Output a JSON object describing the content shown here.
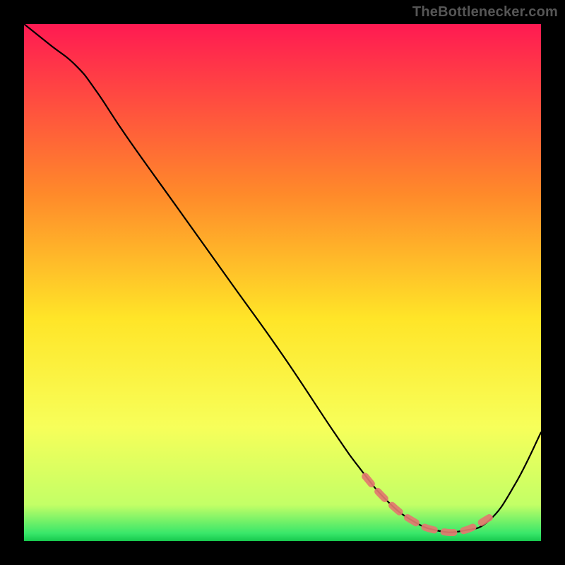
{
  "attribution": "TheBottlenecker.com",
  "chart_data": {
    "type": "line",
    "title": "",
    "xlabel": "",
    "ylabel": "",
    "xlim": [
      0,
      100
    ],
    "ylim": [
      0,
      100
    ],
    "series": [
      {
        "name": "bottleneck-curve",
        "x": [
          0,
          5,
          10,
          14,
          20,
          30,
          40,
          50,
          60,
          65,
          70,
          75,
          80,
          85,
          90,
          95,
          100
        ],
        "y": [
          100,
          96,
          92,
          87,
          78,
          64,
          50,
          36,
          21,
          14,
          8,
          4,
          2,
          2,
          4,
          11,
          21
        ]
      }
    ],
    "highlight_range": {
      "name": "optimal-zone",
      "x": [
        66,
        70,
        75,
        80,
        85,
        90
      ],
      "y": [
        12.5,
        8,
        4,
        2,
        2,
        4.5
      ]
    },
    "gradient_stops": [
      {
        "offset": 0,
        "color": "#ff1a52"
      },
      {
        "offset": 0.33,
        "color": "#ff8a2a"
      },
      {
        "offset": 0.57,
        "color": "#ffe528"
      },
      {
        "offset": 0.78,
        "color": "#f7ff5a"
      },
      {
        "offset": 0.93,
        "color": "#c3ff66"
      },
      {
        "offset": 0.985,
        "color": "#39e76a"
      },
      {
        "offset": 1,
        "color": "#17c94e"
      }
    ]
  }
}
